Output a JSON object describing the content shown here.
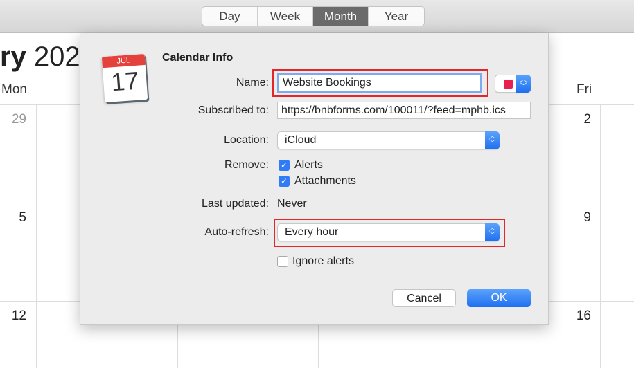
{
  "toolbar": {
    "views": [
      "Day",
      "Week",
      "Month",
      "Year"
    ],
    "active": "Month"
  },
  "calendar": {
    "month_partial": "ry",
    "year_partial": "202",
    "weekdays": {
      "mon": "Mon",
      "fri": "Fri"
    },
    "left_days": [
      "29",
      "5",
      "12"
    ],
    "right_days": [
      "2",
      "9",
      "16"
    ]
  },
  "dialog": {
    "icon": {
      "month": "JUL",
      "day": "17"
    },
    "title": "Calendar Info",
    "name_label": "Name:",
    "name_value": "Website Bookings",
    "color": "#e8204f",
    "subscribed_label": "Subscribed to:",
    "subscribed_value": "https://bnbforms.com/100011/?feed=mphb.ics",
    "location_label": "Location:",
    "location_value": "iCloud",
    "remove_label": "Remove:",
    "remove_options": [
      {
        "label": "Alerts",
        "checked": true
      },
      {
        "label": "Attachments",
        "checked": true
      }
    ],
    "last_updated_label": "Last updated:",
    "last_updated_value": "Never",
    "auto_refresh_label": "Auto-refresh:",
    "auto_refresh_value": "Every hour",
    "ignore_alerts_label": "Ignore alerts",
    "ignore_alerts_checked": false,
    "cancel": "Cancel",
    "ok": "OK",
    "highlight_color": "#e3262a",
    "accent": "#2f7cf6"
  }
}
